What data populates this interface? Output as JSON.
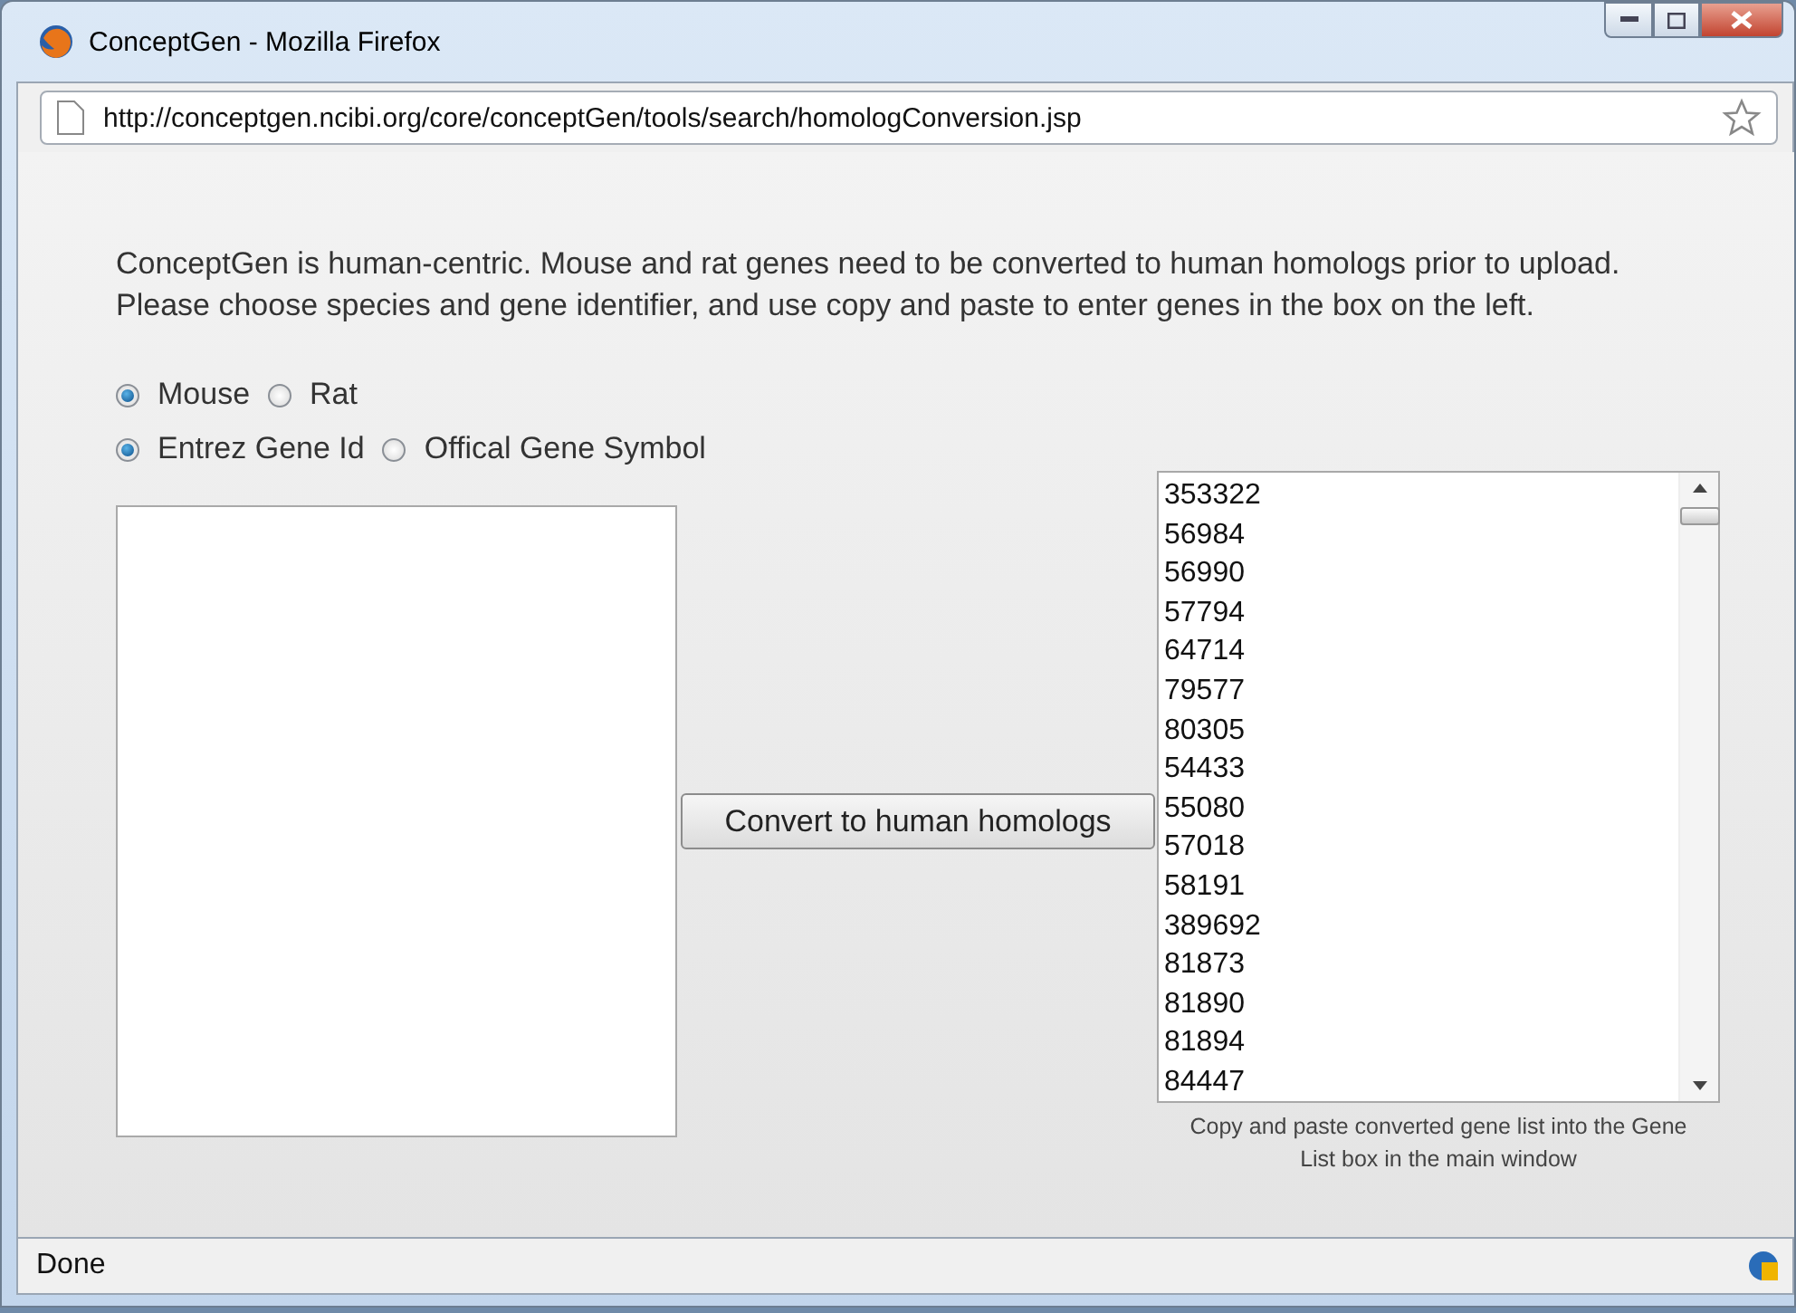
{
  "window": {
    "title": "ConceptGen - Mozilla Firefox"
  },
  "address_bar": {
    "url": "http://conceptgen.ncibi.org/core/conceptGen/tools/search/homologConversion.jsp"
  },
  "intro": "ConceptGen is human-centric. Mouse and rat genes need to be converted to human homologs prior to upload. Please choose species and gene identifier, and use copy and paste to enter genes in the box on the left.",
  "species": [
    {
      "label": "Mouse",
      "selected": true
    },
    {
      "label": "Rat",
      "selected": false
    }
  ],
  "identifier": [
    {
      "label": "Entrez Gene Id",
      "selected": true
    },
    {
      "label": "Offical Gene Symbol",
      "selected": false
    }
  ],
  "convert_button": "Convert to human homologs",
  "converted_genes": [
    "353322",
    "56984",
    "56990",
    "57794",
    "64714",
    "79577",
    "80305",
    "54433",
    "55080",
    "57018",
    "58191",
    "389692",
    "81873",
    "81890",
    "81894",
    "84447"
  ],
  "caption": "Copy and paste converted gene list into the Gene List box in the main window",
  "status_bar": {
    "text": "Done"
  }
}
